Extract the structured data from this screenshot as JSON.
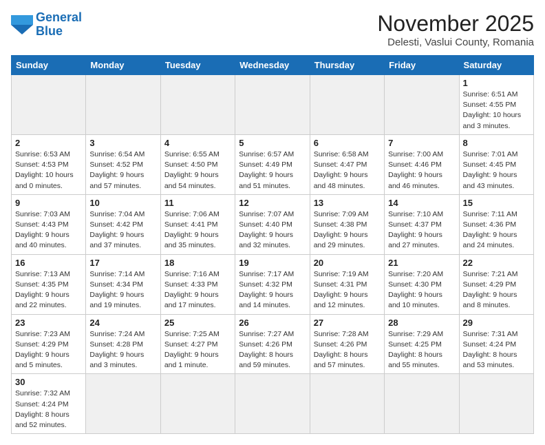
{
  "header": {
    "logo_general": "General",
    "logo_blue": "Blue",
    "month_title": "November 2025",
    "location": "Delesti, Vaslui County, Romania"
  },
  "weekdays": [
    "Sunday",
    "Monday",
    "Tuesday",
    "Wednesday",
    "Thursday",
    "Friday",
    "Saturday"
  ],
  "weeks": [
    [
      {
        "day": "",
        "empty": true
      },
      {
        "day": "",
        "empty": true
      },
      {
        "day": "",
        "empty": true
      },
      {
        "day": "",
        "empty": true
      },
      {
        "day": "",
        "empty": true
      },
      {
        "day": "",
        "empty": true
      },
      {
        "day": "1",
        "sunrise": "6:51 AM",
        "sunset": "4:55 PM",
        "daylight": "10 hours and 3 minutes."
      }
    ],
    [
      {
        "day": "2",
        "sunrise": "6:53 AM",
        "sunset": "4:53 PM",
        "daylight": "10 hours and 0 minutes."
      },
      {
        "day": "3",
        "sunrise": "6:54 AM",
        "sunset": "4:52 PM",
        "daylight": "9 hours and 57 minutes."
      },
      {
        "day": "4",
        "sunrise": "6:55 AM",
        "sunset": "4:50 PM",
        "daylight": "9 hours and 54 minutes."
      },
      {
        "day": "5",
        "sunrise": "6:57 AM",
        "sunset": "4:49 PM",
        "daylight": "9 hours and 51 minutes."
      },
      {
        "day": "6",
        "sunrise": "6:58 AM",
        "sunset": "4:47 PM",
        "daylight": "9 hours and 48 minutes."
      },
      {
        "day": "7",
        "sunrise": "7:00 AM",
        "sunset": "4:46 PM",
        "daylight": "9 hours and 46 minutes."
      },
      {
        "day": "8",
        "sunrise": "7:01 AM",
        "sunset": "4:45 PM",
        "daylight": "9 hours and 43 minutes."
      }
    ],
    [
      {
        "day": "9",
        "sunrise": "7:03 AM",
        "sunset": "4:43 PM",
        "daylight": "9 hours and 40 minutes."
      },
      {
        "day": "10",
        "sunrise": "7:04 AM",
        "sunset": "4:42 PM",
        "daylight": "9 hours and 37 minutes."
      },
      {
        "day": "11",
        "sunrise": "7:06 AM",
        "sunset": "4:41 PM",
        "daylight": "9 hours and 35 minutes."
      },
      {
        "day": "12",
        "sunrise": "7:07 AM",
        "sunset": "4:40 PM",
        "daylight": "9 hours and 32 minutes."
      },
      {
        "day": "13",
        "sunrise": "7:09 AM",
        "sunset": "4:38 PM",
        "daylight": "9 hours and 29 minutes."
      },
      {
        "day": "14",
        "sunrise": "7:10 AM",
        "sunset": "4:37 PM",
        "daylight": "9 hours and 27 minutes."
      },
      {
        "day": "15",
        "sunrise": "7:11 AM",
        "sunset": "4:36 PM",
        "daylight": "9 hours and 24 minutes."
      }
    ],
    [
      {
        "day": "16",
        "sunrise": "7:13 AM",
        "sunset": "4:35 PM",
        "daylight": "9 hours and 22 minutes."
      },
      {
        "day": "17",
        "sunrise": "7:14 AM",
        "sunset": "4:34 PM",
        "daylight": "9 hours and 19 minutes."
      },
      {
        "day": "18",
        "sunrise": "7:16 AM",
        "sunset": "4:33 PM",
        "daylight": "9 hours and 17 minutes."
      },
      {
        "day": "19",
        "sunrise": "7:17 AM",
        "sunset": "4:32 PM",
        "daylight": "9 hours and 14 minutes."
      },
      {
        "day": "20",
        "sunrise": "7:19 AM",
        "sunset": "4:31 PM",
        "daylight": "9 hours and 12 minutes."
      },
      {
        "day": "21",
        "sunrise": "7:20 AM",
        "sunset": "4:30 PM",
        "daylight": "9 hours and 10 minutes."
      },
      {
        "day": "22",
        "sunrise": "7:21 AM",
        "sunset": "4:29 PM",
        "daylight": "9 hours and 8 minutes."
      }
    ],
    [
      {
        "day": "23",
        "sunrise": "7:23 AM",
        "sunset": "4:29 PM",
        "daylight": "9 hours and 5 minutes."
      },
      {
        "day": "24",
        "sunrise": "7:24 AM",
        "sunset": "4:28 PM",
        "daylight": "9 hours and 3 minutes."
      },
      {
        "day": "25",
        "sunrise": "7:25 AM",
        "sunset": "4:27 PM",
        "daylight": "9 hours and 1 minute."
      },
      {
        "day": "26",
        "sunrise": "7:27 AM",
        "sunset": "4:26 PM",
        "daylight": "8 hours and 59 minutes."
      },
      {
        "day": "27",
        "sunrise": "7:28 AM",
        "sunset": "4:26 PM",
        "daylight": "8 hours and 57 minutes."
      },
      {
        "day": "28",
        "sunrise": "7:29 AM",
        "sunset": "4:25 PM",
        "daylight": "8 hours and 55 minutes."
      },
      {
        "day": "29",
        "sunrise": "7:31 AM",
        "sunset": "4:24 PM",
        "daylight": "8 hours and 53 minutes."
      }
    ],
    [
      {
        "day": "30",
        "sunrise": "7:32 AM",
        "sunset": "4:24 PM",
        "daylight": "8 hours and 52 minutes."
      },
      {
        "day": "",
        "empty": true
      },
      {
        "day": "",
        "empty": true
      },
      {
        "day": "",
        "empty": true
      },
      {
        "day": "",
        "empty": true
      },
      {
        "day": "",
        "empty": true
      },
      {
        "day": "",
        "empty": true
      }
    ]
  ]
}
